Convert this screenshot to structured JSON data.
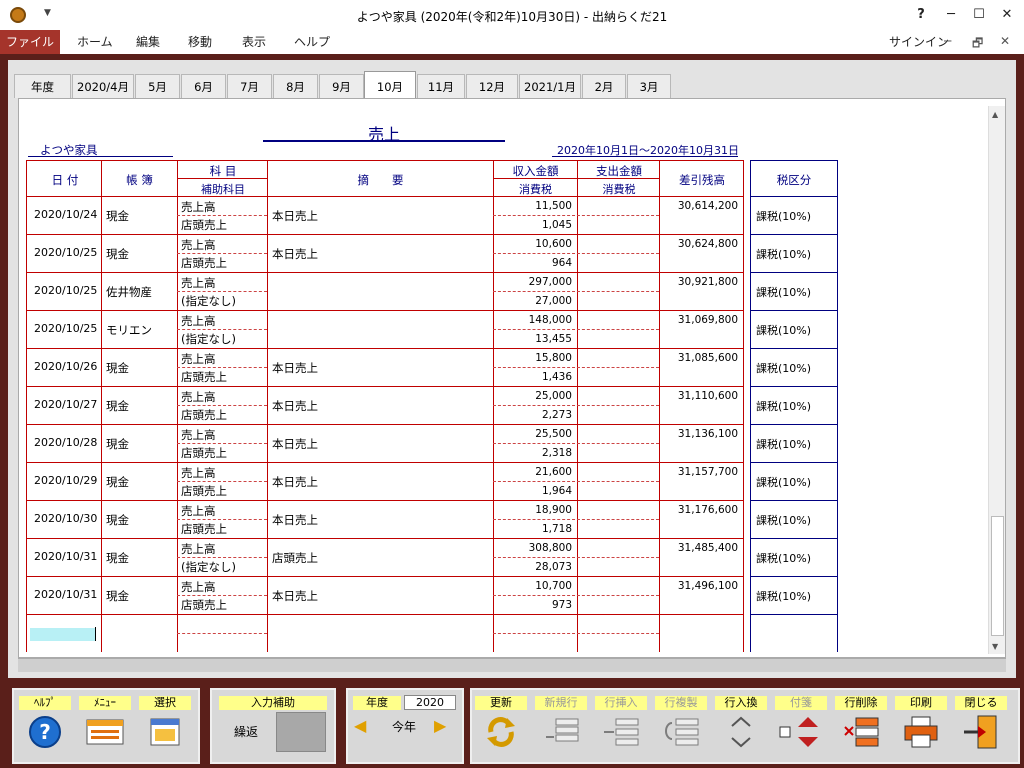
{
  "window": {
    "title": "よつや家具 (2020年(令和2年)10月30日) - 出納らくだ21",
    "help_icon": "?",
    "minimize_icon": "─",
    "maximize_icon": "☐",
    "close_icon": "✕"
  },
  "menu": {
    "file": "ファイル",
    "items": [
      "ホーム",
      "編集",
      "移動",
      "表示",
      "ヘルプ"
    ],
    "signin": "サインイン",
    "ribbon_min": "─",
    "ribbon_restore": "🗗",
    "ribbon_close": "✕"
  },
  "tabs": [
    "年度",
    "2020/4月",
    "5月",
    "6月",
    "7月",
    "8月",
    "9月",
    "10月",
    "11月",
    "12月",
    "2021/1月",
    "2月",
    "3月"
  ],
  "active_tab": "10月",
  "sheet": {
    "title": "売上",
    "company": "よつや家具",
    "period": "2020年10月1日～2020年10月31日",
    "headers": {
      "date": "日 付",
      "book": "帳 簿",
      "account": "科 目",
      "sub_account": "補助科目",
      "summary": "摘　　要",
      "income": "収入金額",
      "income_tax": "消費税",
      "expense": "支出金額",
      "expense_tax": "消費税",
      "balance": "差引残高",
      "tax_class": "税区分"
    },
    "rows": [
      {
        "date": "2020/10/24",
        "book": "現金",
        "account": "売上高",
        "sub": "店頭売上",
        "summary": "本日売上",
        "income": "11,500",
        "tax": "1,045",
        "balance": "30,614,200",
        "tax_class": "課税(10%)"
      },
      {
        "date": "2020/10/25",
        "book": "現金",
        "account": "売上高",
        "sub": "店頭売上",
        "summary": "本日売上",
        "income": "10,600",
        "tax": "964",
        "balance": "30,624,800",
        "tax_class": "課税(10%)"
      },
      {
        "date": "2020/10/25",
        "book": "佐井物産",
        "account": "売上高",
        "sub": "(指定なし)",
        "summary": "",
        "income": "297,000",
        "tax": "27,000",
        "balance": "30,921,800",
        "tax_class": "課税(10%)"
      },
      {
        "date": "2020/10/25",
        "book": "モリエン",
        "account": "売上高",
        "sub": "(指定なし)",
        "summary": "",
        "income": "148,000",
        "tax": "13,455",
        "balance": "31,069,800",
        "tax_class": "課税(10%)"
      },
      {
        "date": "2020/10/26",
        "book": "現金",
        "account": "売上高",
        "sub": "店頭売上",
        "summary": "本日売上",
        "income": "15,800",
        "tax": "1,436",
        "balance": "31,085,600",
        "tax_class": "課税(10%)"
      },
      {
        "date": "2020/10/27",
        "book": "現金",
        "account": "売上高",
        "sub": "店頭売上",
        "summary": "本日売上",
        "income": "25,000",
        "tax": "2,273",
        "balance": "31,110,600",
        "tax_class": "課税(10%)"
      },
      {
        "date": "2020/10/28",
        "book": "現金",
        "account": "売上高",
        "sub": "店頭売上",
        "summary": "本日売上",
        "income": "25,500",
        "tax": "2,318",
        "balance": "31,136,100",
        "tax_class": "課税(10%)"
      },
      {
        "date": "2020/10/29",
        "book": "現金",
        "account": "売上高",
        "sub": "店頭売上",
        "summary": "本日売上",
        "income": "21,600",
        "tax": "1,964",
        "balance": "31,157,700",
        "tax_class": "課税(10%)"
      },
      {
        "date": "2020/10/30",
        "book": "現金",
        "account": "売上高",
        "sub": "店頭売上",
        "summary": "本日売上",
        "income": "18,900",
        "tax": "1,718",
        "balance": "31,176,600",
        "tax_class": "課税(10%)"
      },
      {
        "date": "2020/10/31",
        "book": "現金",
        "account": "売上高",
        "sub": "(指定なし)",
        "summary": "店頭売上",
        "income": "308,800",
        "tax": "28,073",
        "balance": "31,485,400",
        "tax_class": "課税(10%)"
      },
      {
        "date": "2020/10/31",
        "book": "現金",
        "account": "売上高",
        "sub": "店頭売上",
        "summary": "本日売上",
        "income": "10,700",
        "tax": "973",
        "balance": "31,496,100",
        "tax_class": "課税(10%)"
      }
    ]
  },
  "toolbar": {
    "help": "ﾍﾙﾌﾟ",
    "menu": "ﾒﾆｭｰ",
    "select": "選択",
    "input_assist": "入力補助",
    "carry": "繰返",
    "year_label": "年度",
    "year_value": "2020",
    "this_year": "今年",
    "update": "更新",
    "new_row": "新規行",
    "insert_row": "行挿入",
    "copy_row": "行複製",
    "swap_row": "行入換",
    "tag": "付箋",
    "delete_row": "行削除",
    "print": "印刷",
    "close": "閉じる"
  },
  "colors": {
    "accent": "#a5342b",
    "frame": "#5a1f1a",
    "grid": "#c00000",
    "header_text": "#000080",
    "label_bg": "#ffff8a"
  }
}
